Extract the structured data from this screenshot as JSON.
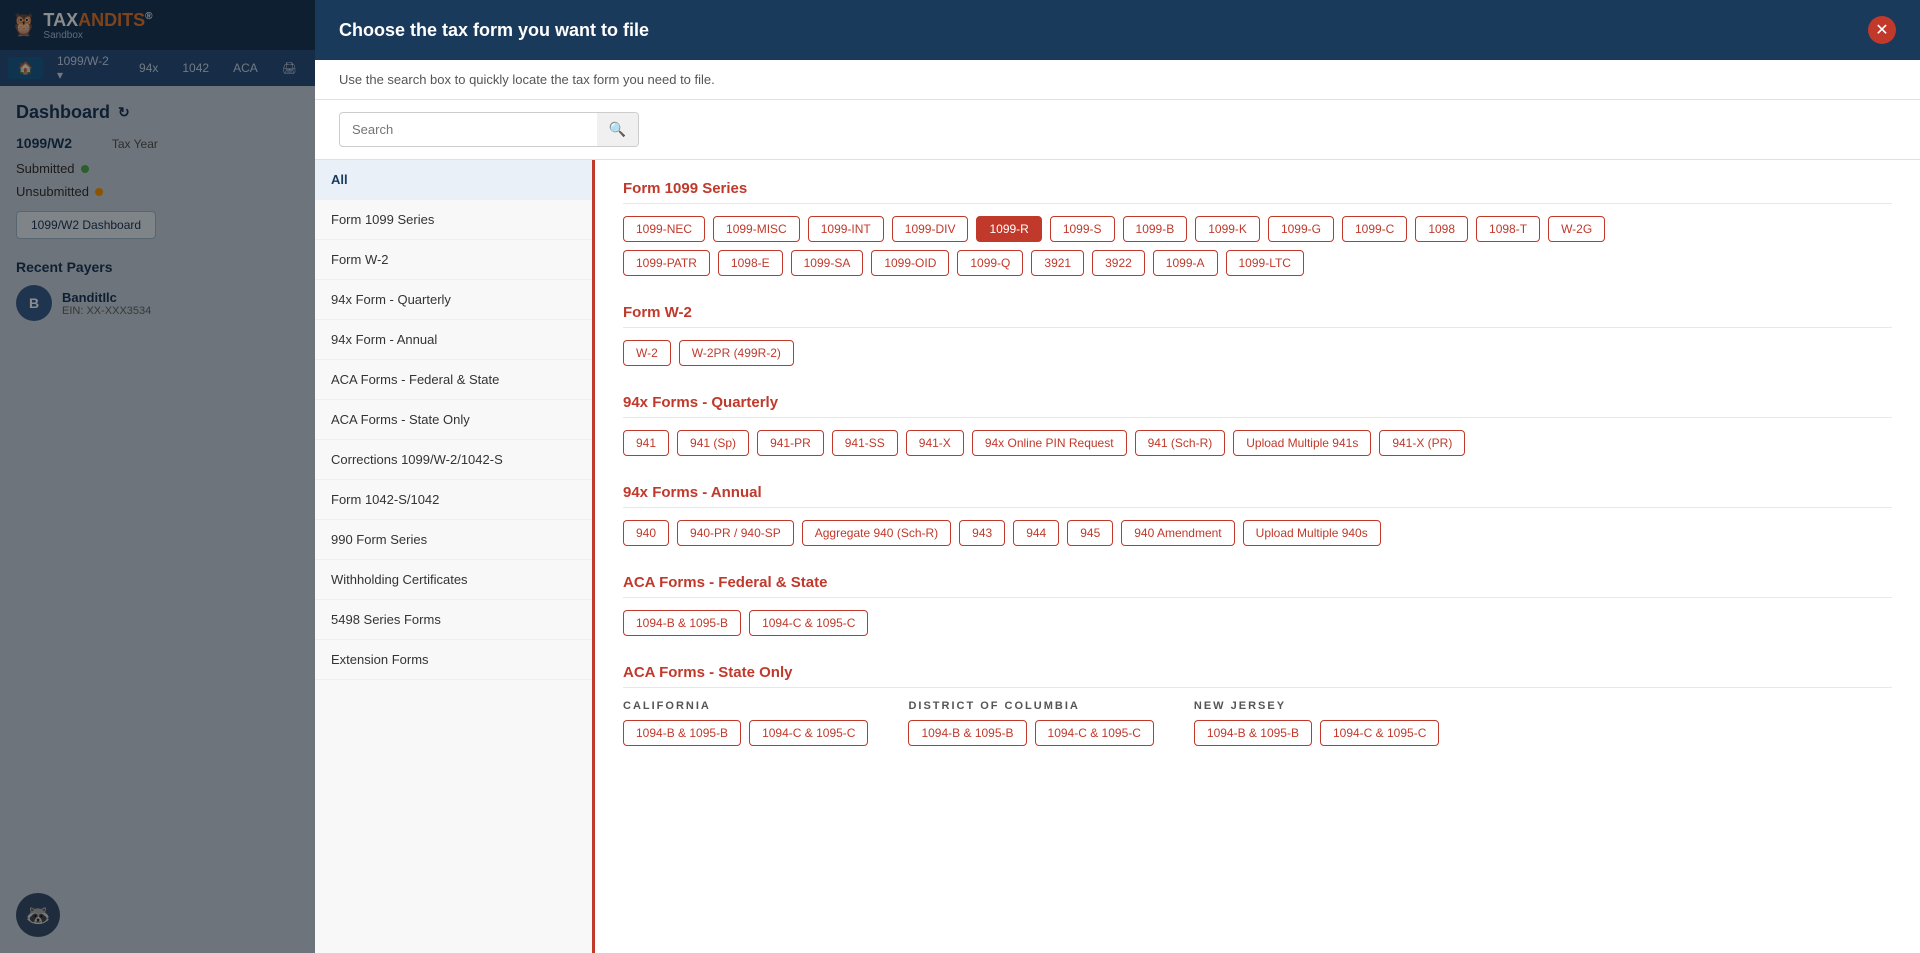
{
  "app": {
    "name": "TAX",
    "brand": "ANDITS",
    "trademark": "®",
    "sub": "Sandbox"
  },
  "nav": {
    "home_icon": "🏠",
    "items": [
      "1099/W-2 ▾",
      "94x",
      "1042",
      "ACA",
      "🖨"
    ]
  },
  "sidebar": {
    "dashboard_title": "Dashboard",
    "form_type": "1099/W2",
    "tax_year_label": "Tax Year",
    "submitted_label": "Submitted",
    "unsubmitted_label": "Unsubmitted",
    "dashboard_btn": "1099/W2 Dashboard",
    "recent_payers_title": "Recent Payers",
    "payer_name": "BanditIlc",
    "payer_ein": "EIN: XX-XXX3534",
    "payer_initial": "B"
  },
  "modal": {
    "title": "Choose the tax form you want to file",
    "subtitle": "Use the search box to quickly locate the tax form you need to file.",
    "close_icon": "✕",
    "search_placeholder": "Search"
  },
  "categories": [
    {
      "id": "all",
      "label": "All",
      "active": true
    },
    {
      "id": "1099",
      "label": "Form 1099 Series",
      "active": false
    },
    {
      "id": "w2",
      "label": "Form W-2",
      "active": false
    },
    {
      "id": "94x-q",
      "label": "94x Form - Quarterly",
      "active": false
    },
    {
      "id": "94x-a",
      "label": "94x Form - Annual",
      "active": false
    },
    {
      "id": "aca-fed",
      "label": "ACA Forms - Federal & State",
      "active": false
    },
    {
      "id": "aca-state",
      "label": "ACA Forms - State Only",
      "active": false
    },
    {
      "id": "corrections",
      "label": "Corrections 1099/W-2/1042-S",
      "active": false
    },
    {
      "id": "1042",
      "label": "Form 1042-S/1042",
      "active": false
    },
    {
      "id": "990",
      "label": "990 Form Series",
      "active": false
    },
    {
      "id": "withholding",
      "label": "Withholding Certificates",
      "active": false
    },
    {
      "id": "5498",
      "label": "5498 Series Forms",
      "active": false
    },
    {
      "id": "extension",
      "label": "Extension Forms",
      "active": false
    }
  ],
  "sections": {
    "form1099": {
      "title": "Form 1099 Series",
      "row1": [
        "1099-NEC",
        "1099-MISC",
        "1099-INT",
        "1099-DIV",
        "1099-R",
        "1099-S",
        "1099-B",
        "1099-K",
        "1099-G",
        "1099-C",
        "1098",
        "1098-T",
        "W-2G"
      ],
      "row2": [
        "1099-PATR",
        "1098-E",
        "1099-SA",
        "1099-OID",
        "1099-Q",
        "3921",
        "3922",
        "1099-A",
        "1099-LTC"
      ],
      "selected": "1099-R"
    },
    "formW2": {
      "title": "Form W-2",
      "tags": [
        "W-2",
        "W-2PR (499R-2)"
      ]
    },
    "quarterly": {
      "title": "94x Forms - Quarterly",
      "tags": [
        "941",
        "941 (Sp)",
        "941-PR",
        "941-SS",
        "941-X",
        "94x Online PIN Request",
        "941 (Sch-R)",
        "Upload Multiple 941s",
        "941-X (PR)"
      ]
    },
    "annual": {
      "title": "94x Forms - Annual",
      "tags": [
        "940",
        "940-PR / 940-SP",
        "Aggregate 940 (Sch-R)",
        "943",
        "944",
        "945",
        "940 Amendment",
        "Upload Multiple 940s"
      ]
    },
    "acaFederal": {
      "title": "ACA Forms - Federal & State",
      "tags": [
        "1094-B & 1095-B",
        "1094-C & 1095-C"
      ]
    },
    "acaState": {
      "title": "ACA Forms - State Only",
      "states": [
        {
          "name": "CALIFORNIA",
          "tags": [
            "1094-B & 1095-B",
            "1094-C & 1095-C"
          ]
        },
        {
          "name": "DISTRICT OF COLUMBIA",
          "tags": [
            "1094-B & 1095-B",
            "1094-C & 1095-C"
          ]
        },
        {
          "name": "NEW JERSEY",
          "tags": [
            "1094-B & 1095-B",
            "1094-C & 1095-C"
          ]
        }
      ]
    }
  }
}
